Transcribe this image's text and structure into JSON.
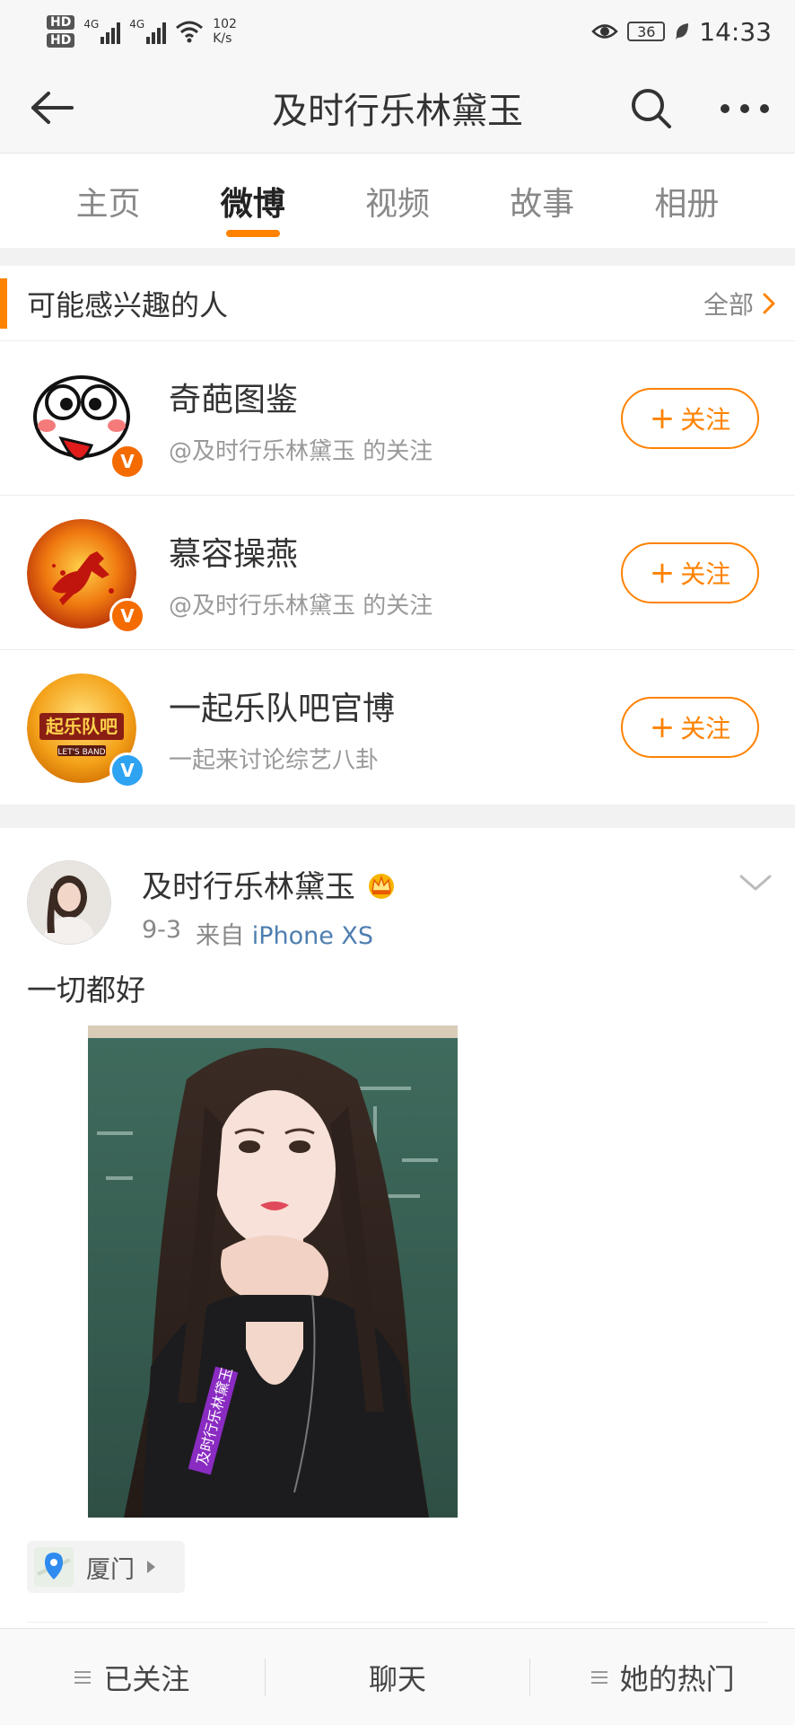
{
  "status_bar": {
    "hd_labels": [
      "HD",
      "HD"
    ],
    "sim_labels": [
      "4G",
      "4G"
    ],
    "net_speed": "102",
    "net_unit": "K/s",
    "battery": "36",
    "time": "14:33"
  },
  "header": {
    "title": "及时行乐林黛玉"
  },
  "tabs": [
    {
      "label": "主页",
      "active": false
    },
    {
      "label": "微博",
      "active": true
    },
    {
      "label": "视频",
      "active": false
    },
    {
      "label": "故事",
      "active": false
    },
    {
      "label": "相册",
      "active": false
    }
  ],
  "suggestions": {
    "title": "可能感兴趣的人",
    "all_label": "全部",
    "follow_plus": "+",
    "follow_label": "关注",
    "people": [
      {
        "name": "奇葩图鉴",
        "subtitle": "@及时行乐林黛玉 的关注",
        "badge": "V",
        "badge_color": "#f46b00"
      },
      {
        "name": "慕容操燕",
        "subtitle": "@及时行乐林黛玉 的关注",
        "badge": "V",
        "badge_color": "#f46b00"
      },
      {
        "name": "一起乐队吧官博",
        "subtitle": "一起来讨论综艺八卦",
        "badge": "V",
        "badge_color": "#2ea3f2"
      }
    ],
    "band_logo_text": "起乐队吧",
    "band_logo_sub": "LET'S BAND"
  },
  "post": {
    "author": "及时行乐林黛玉",
    "date": "9-3",
    "source_prefix": "来自",
    "source": "iPhone XS",
    "text": "一切都好",
    "image_watermark": "及时行乐林黛玉",
    "location": "厦门"
  },
  "bottom_bar": {
    "items": [
      {
        "label": "已关注",
        "has_icon": true
      },
      {
        "label": "聊天",
        "has_icon": false
      },
      {
        "label": "她的热门",
        "has_icon": true
      }
    ]
  },
  "colors": {
    "accent": "#ff8200",
    "link": "#4e7eb0",
    "verified_orange": "#f46b00",
    "verified_blue": "#2ea3f2"
  }
}
